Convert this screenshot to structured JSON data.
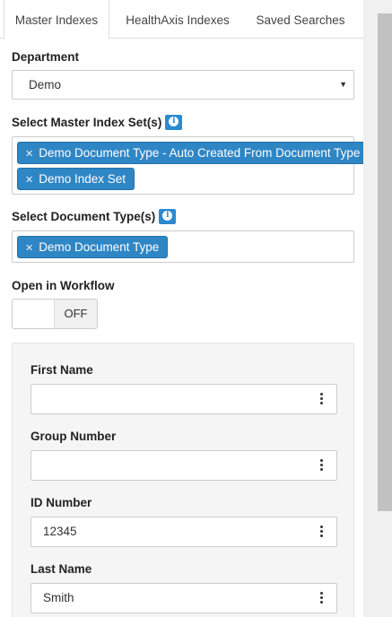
{
  "tabs": [
    {
      "label": "Master Indexes",
      "active": true
    },
    {
      "label": "HealthAxis Indexes",
      "active": false
    },
    {
      "label": "Saved Searches",
      "active": false
    }
  ],
  "department": {
    "label": "Department",
    "selected": "Demo"
  },
  "master_index_sets": {
    "label": "Select Master Index Set(s)",
    "tags": [
      "Demo Document Type - Auto Created From Document Type",
      "Demo Index Set"
    ]
  },
  "document_types": {
    "label": "Select Document Type(s)",
    "tags": [
      "Demo Document Type"
    ]
  },
  "workflow": {
    "label": "Open in Workflow",
    "toggle_text": "OFF",
    "on": false
  },
  "fields": [
    {
      "label": "First Name",
      "value": ""
    },
    {
      "label": "Group Number",
      "value": ""
    },
    {
      "label": "ID Number",
      "value": "12345"
    },
    {
      "label": "Last Name",
      "value": "Smith"
    }
  ],
  "colors": {
    "accent": "#2f86c5",
    "panel_bg": "#f5f5f5"
  }
}
